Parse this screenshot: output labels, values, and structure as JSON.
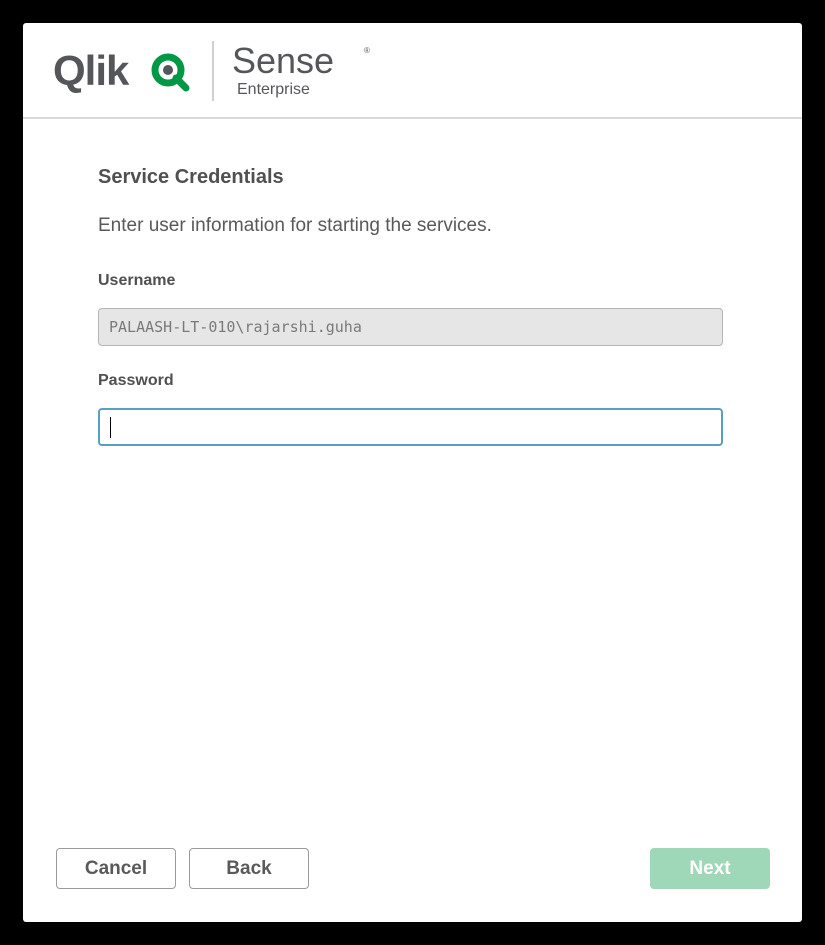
{
  "brand": {
    "logo_word": "Qlik",
    "product": "Sense",
    "edition": "Enterprise",
    "registered_mark": "®",
    "brand_color": "#009845",
    "logo_text_color": "#54565a"
  },
  "page": {
    "title": "Service Credentials",
    "description": "Enter user information for starting the services."
  },
  "form": {
    "username": {
      "label": "Username",
      "value": "PALAASH-LT-010\\rajarshi.guha",
      "disabled": true
    },
    "password": {
      "label": "Password",
      "value": "",
      "focused": true
    }
  },
  "buttons": {
    "cancel": "Cancel",
    "back": "Back",
    "next": "Next",
    "next_enabled": false
  },
  "icons": {
    "logo_icon": "qlik-q-icon"
  }
}
